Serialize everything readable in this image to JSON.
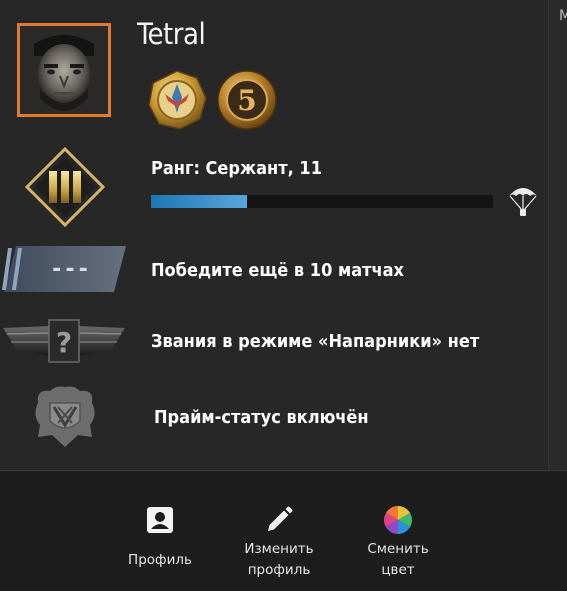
{
  "profile": {
    "username": "Tetral",
    "edge_fragment": "M"
  },
  "rank": {
    "label": "Ранг: Сержант, 11",
    "xp_progress_fraction": 0.28
  },
  "competitive": {
    "wins_needed_label": "Победите ещё в 10 матчах",
    "placeholder_text": "---"
  },
  "wingman": {
    "label": "Звания в режиме «Напарники» нет",
    "symbol": "?"
  },
  "prime": {
    "label": "Прайм-статус включён"
  },
  "coins": [
    {
      "icon": "service-medal-icon"
    },
    {
      "icon": "five-year-veteran-coin-icon",
      "glyph": "5"
    }
  ],
  "footer": {
    "profile_label": "Профиль",
    "edit_label_line1": "Изменить",
    "edit_label_line2": "профиль",
    "color_label_line1": "Сменить",
    "color_label_line2": "цвет"
  },
  "colors": {
    "avatar_border": "#e07a2e",
    "xp_fill": "#3d8fcc",
    "background": "#272727",
    "footer_bg": "#1d1d1d"
  }
}
